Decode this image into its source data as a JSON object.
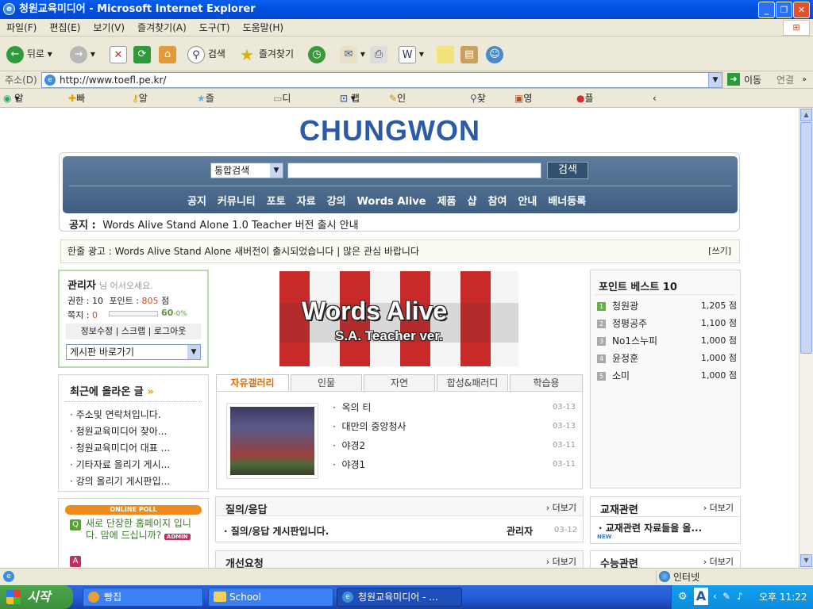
{
  "window": {
    "title": "청원교육미디어 - Microsoft Internet Explorer"
  },
  "menu": [
    "파일(F)",
    "편집(E)",
    "보기(V)",
    "즐겨찾기(A)",
    "도구(T)",
    "도움말(H)"
  ],
  "toolbar": {
    "back": "뒤로",
    "search": "검색",
    "favorites": "즐겨찾기"
  },
  "address": {
    "label": "주소(D)",
    "url": "http://www.toefl.pe.kr/",
    "go": "이동",
    "links": "연결"
  },
  "linkbar": [
    "알툴바",
    "빠른검색",
    "알패스On",
    "즐겨찾기On",
    "디스크On",
    "캡쳐",
    "인터넷클리닝",
    "찾기",
    "영한사전",
    "플래시제한"
  ],
  "page": {
    "logo": "CHUNGWON",
    "search_select": "통합검색",
    "search_button": "검색",
    "nav": [
      "공지",
      "커뮤니티",
      "포토",
      "자료",
      "강의",
      "Words Alive",
      "제품",
      "샵",
      "참여",
      "안내",
      "배너등록"
    ],
    "notice_label": "공지 :",
    "notice_text": "Words Alive Stand Alone 1.0 Teacher 버전 출시 안내",
    "ad_text": "한줄 광고 : Words Alive Stand Alone 새버전이 출시되었습니다 | 많은 관심 바랍니다",
    "ad_write": "[쓰기]",
    "login": {
      "name": "관리자",
      "greeting": "님 어서오세요.",
      "level_label": "권한 : 10",
      "point_label": "포인트 :",
      "point_value": "805",
      "point_unit": "점",
      "memo_label": "쪽지 :",
      "memo_value": "0",
      "progress_text": "60",
      "progress_unit": "-0%",
      "progress_fraction": 0.0,
      "links": [
        "정보수정",
        "스크랩",
        "로그아웃"
      ],
      "board_select": "게시판 바로가기"
    },
    "recent": {
      "title": "최근에 올라온 글",
      "items": [
        "주소및 연락처입니다.",
        "청원교육미디어 찾아...",
        "청원교육미디어 대표 ...",
        "기타자료 올리기 게시...",
        "강의 올리기 게시판입..."
      ]
    },
    "poll": {
      "header": "ONLINE POLL",
      "question": "새로 단장한 홈페이지 입니다. 맘에 드십니까?",
      "badge": "ADMIN"
    },
    "banner": {
      "line1": "Words Alive",
      "line2": "S.A. Teacher ver."
    },
    "gallery": {
      "tabs": [
        "자유갤러리",
        "인물",
        "자연",
        "합성&패러디",
        "학습용"
      ],
      "items": [
        {
          "title": "옥의 티",
          "date": "03-13"
        },
        {
          "title": "대만의 중앙청사",
          "date": "03-13"
        },
        {
          "title": "야경2",
          "date": "03-11"
        },
        {
          "title": "야경1",
          "date": "03-11"
        }
      ]
    },
    "qa": {
      "title": "질의/응답",
      "more": "더보기",
      "post": "질의/응답 게시판입니다.",
      "author": "관리자",
      "date": "03-12"
    },
    "request": {
      "title": "개선요청",
      "more": "더보기"
    },
    "points": {
      "title": "포인트 베스트 10",
      "rows": [
        {
          "rank": "1",
          "name": "청원광",
          "score": "1,205 점"
        },
        {
          "rank": "2",
          "name": "정평공주",
          "score": "1,100 점"
        },
        {
          "rank": "3",
          "name": "No1스누피",
          "score": "1,000 점"
        },
        {
          "rank": "4",
          "name": "윤정훈",
          "score": "1,000 점"
        },
        {
          "rank": "5",
          "name": "소미",
          "score": "1,000 점"
        }
      ]
    },
    "edu": {
      "title": "교재관련",
      "more": "더보기",
      "post": "교재관련 자료들을 올...",
      "badge": "NEW"
    },
    "course": {
      "title": "수능관련",
      "more": "더보기"
    }
  },
  "status": {
    "zone": "인터넷"
  },
  "taskbar": {
    "start": "시작",
    "tasks": [
      "빵집",
      "School",
      "청원교육미디어 - ..."
    ],
    "time": "오후 11:22"
  },
  "colors": {
    "accent": "#2a5aa8",
    "nav_band": "#4a6a8e",
    "poll_header": "#f08a1c"
  }
}
